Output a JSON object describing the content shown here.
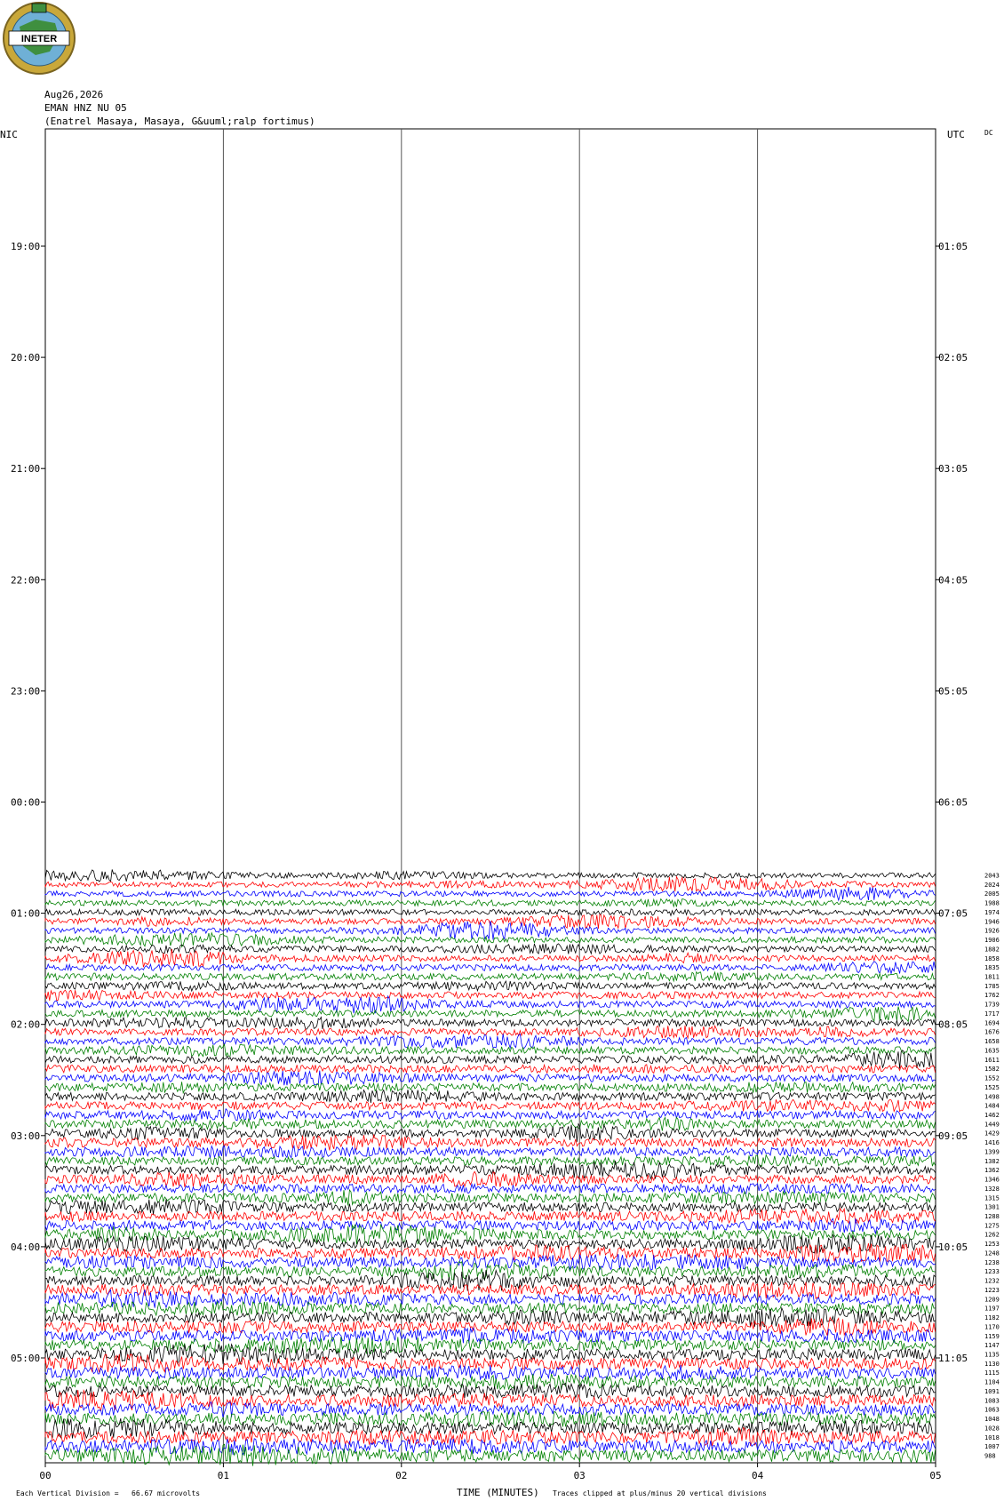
{
  "header": {
    "date": "Aug26,2026",
    "station": "EMAN HNZ NU 05",
    "location": "(Enatrel Masaya, Masaya, G&uuml;ralp fortimus)"
  },
  "logo": {
    "text": "INETER",
    "ring_color": "#c9a83a",
    "globe_color": "#6fb0d6",
    "land_color": "#3f8f3f"
  },
  "left_axis_title": "NIC",
  "right_axis_title": "UTC",
  "dc_label": "DC",
  "left_times": [
    "19:00",
    "20:00",
    "21:00",
    "22:00",
    "23:00",
    "00:00",
    "01:00",
    "02:00",
    "03:00",
    "04:00",
    "05:00"
  ],
  "right_times": [
    "01:05",
    "02:05",
    "03:05",
    "04:05",
    "05:05",
    "06:05",
    "07:05",
    "08:05",
    "09:05",
    "10:05",
    "11:05"
  ],
  "footer": {
    "scale_text": "Each Vertical Division =   66.67 microvolts",
    "xlabel": "TIME (MINUTES)",
    "clip_text": "Traces clipped at plus/minus 20 vertical divisions"
  },
  "chart_data": {
    "type": "line",
    "xlabel": "TIME (MINUTES)",
    "xlim": [
      0,
      5
    ],
    "x_ticks": [
      "00",
      "01",
      "02",
      "03",
      "04",
      "05"
    ],
    "trace_colors": [
      "#000000",
      "#ff0000",
      "#0000ff",
      "#008000"
    ],
    "trace_labels": [
      "2043",
      "2024",
      "2005",
      "1988",
      "1974",
      "1946",
      "1926",
      "1906",
      "1882",
      "1858",
      "1835",
      "1811",
      "1785",
      "1762",
      "1739",
      "1717",
      "1694",
      "1676",
      "1658",
      "1635",
      "1611",
      "1582",
      "1552",
      "1525",
      "1498",
      "1484",
      "1462",
      "1449",
      "1429",
      "1416",
      "1399",
      "1382",
      "1362",
      "1346",
      "1328",
      "1315",
      "1301",
      "1288",
      "1275",
      "1262",
      "1253",
      "1248",
      "1238",
      "1233",
      "1232",
      "1223",
      "1209",
      "1197",
      "1182",
      "1170",
      "1159",
      "1147",
      "1135",
      "1130",
      "1115",
      "1104",
      "1091",
      "1083",
      "1063",
      "1048",
      "1028",
      "1018",
      "1007",
      "988"
    ]
  }
}
